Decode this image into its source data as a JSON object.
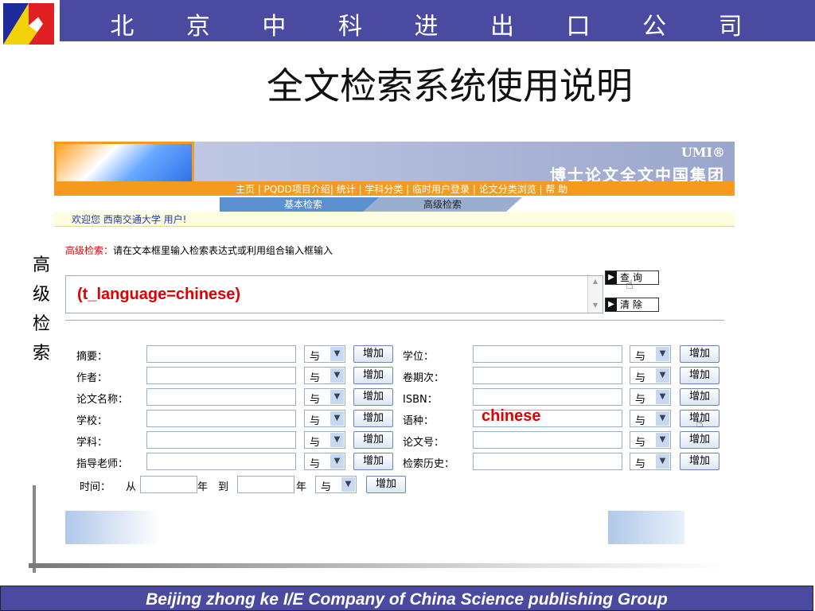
{
  "header": {
    "company": "北 京 中 科 进 出 口 公 司",
    "title": "全文检索系统使用说明"
  },
  "side_label": [
    "高",
    "级",
    "检",
    "索"
  ],
  "site": {
    "umi": "UMI®",
    "brand": "博士论文全文中国集团",
    "nav": "主页 | PQDD项目介绍| 统计 | 学科分类 | 临时用户登录 | 论文分类浏览 | 帮 助",
    "tabs": [
      "基本检索",
      "高级检索"
    ],
    "welcome": "欢迎您 西南交通大学 用户!"
  },
  "search": {
    "hint_label": "高级检索：",
    "hint_text": "请在文本框里输入检索表达式或利用组合输入框输入",
    "query": "(t_language=chinese)",
    "query_button": "查 询",
    "clear_button": "清 除"
  },
  "fields": {
    "left": [
      "摘要：",
      "作者：",
      "论文名称：",
      "学校：",
      "学科：",
      "指导老师："
    ],
    "right": [
      "学位：",
      "卷期次：",
      "ISBN：",
      "语种：",
      "论文号：",
      "检索历史："
    ],
    "language_value": "chinese",
    "operator": "与",
    "add_label": "增加"
  },
  "time_row": {
    "label": "时间：",
    "from": "从",
    "year1": "年",
    "to": "到",
    "year2": "年",
    "operator": "与",
    "add_label": "增加"
  },
  "footer": "Beijing  zhong ke I/E Company of China Science publishing Group",
  "colors": {
    "bar": "#4a4aa0",
    "orange": "#f49b1e",
    "red": "#dd0000"
  }
}
